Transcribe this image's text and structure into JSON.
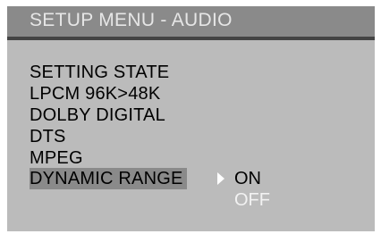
{
  "title": "SETUP MENU - AUDIO",
  "menu": {
    "items": [
      {
        "label": "SETTING STATE"
      },
      {
        "label": "LPCM 96K>48K"
      },
      {
        "label": "DOLBY DIGITAL"
      },
      {
        "label": "DTS"
      },
      {
        "label": "MPEG"
      },
      {
        "label": "DYNAMIC RANGE"
      }
    ],
    "selected_index": 5
  },
  "submenu": {
    "options": [
      {
        "label": "ON"
      },
      {
        "label": "OFF"
      }
    ],
    "highlighted": "ON"
  },
  "colors": {
    "background": "#bbbbbb",
    "title_bar": "#8a8a8a",
    "title_rule": "#444444",
    "selected_item_bg": "#8a8a8a",
    "text": "#000000",
    "inactive_option_text": "#f2f2f2"
  },
  "icons": {
    "submenu_arrow": "chevron-right-icon"
  }
}
